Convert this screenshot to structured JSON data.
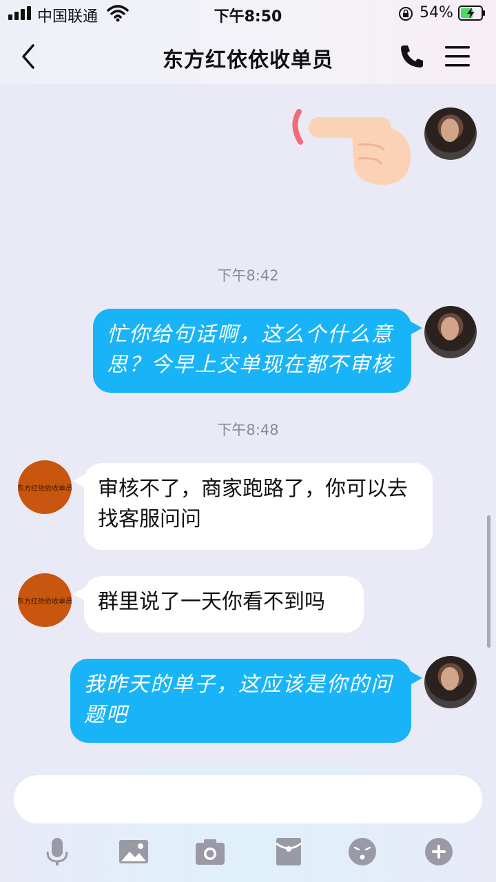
{
  "status_bar": {
    "carrier": "中国联通",
    "time": "下午8:50",
    "battery": "54%"
  },
  "header": {
    "title": "东方红依依收单员",
    "icons": [
      "back-icon",
      "phone-icon",
      "menu-icon"
    ]
  },
  "messages": {
    "time1": "下午8:42",
    "msg1": "忙你给句话啊，这么个什么意思？今早上交单现在都不审核",
    "time2": "下午8:48",
    "msg2": "审核不了，商家跑路了，你可以去找客服问问",
    "msg3": "群里说了一天你看不到吗",
    "msg4": "我昨天的单子，这应该是你的问题吧",
    "store_avatar_text": "东方红依依收单员"
  },
  "toolbar": {
    "icons": [
      "mic-icon",
      "image-icon",
      "camera-icon",
      "red-packet-icon",
      "emoji-icon",
      "plus-icon"
    ]
  },
  "colors": {
    "outgoing_bubble": "#18b4f7",
    "incoming_bubble": "#ffffff",
    "chat_background": "#eaeaf6",
    "store_avatar": "#c8560e"
  }
}
